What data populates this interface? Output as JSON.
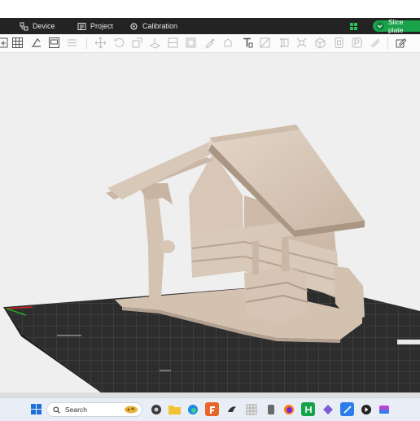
{
  "menubar": {
    "tabs": [
      {
        "label": "Device",
        "icon": "device-icon"
      },
      {
        "label": "Project",
        "icon": "project-icon"
      },
      {
        "label": "Calibration",
        "icon": "calibration-icon"
      }
    ],
    "slice_button_label": "Slice plate",
    "colors": {
      "background": "#232323",
      "accent": "#1aa34a"
    }
  },
  "toolbar": {
    "tools": [
      "add-object-icon",
      "arrange-grid-icon",
      "auto-orient-icon",
      "layout-plate-icon",
      "split-icon",
      "move-icon",
      "rotate-icon",
      "scale-icon",
      "lay-on-face-icon",
      "cut-icon",
      "mesh-boolean-icon",
      "support-paint-icon",
      "text-icon",
      "assembly-icon",
      "measure-icon",
      "cube-icon",
      "variable-layer-icon",
      "seam-paint-icon",
      "color-paint-icon",
      "fuzzy-skin-icon",
      "edit-icon"
    ]
  },
  "viewport": {
    "model": "3D model of a rustic wooden shed with well",
    "colors": {
      "model": "#d9c8b8",
      "plate": "#2d2d2d",
      "plate_grid": "#454545"
    }
  },
  "taskbar": {
    "search_placeholder": "Search",
    "apps": [
      "start-icon",
      "search-icon",
      "widget-icon",
      "file-explorer-icon",
      "edge-icon",
      "app-orange-icon",
      "app-bird-icon",
      "app-grid-icon",
      "firefox-icon",
      "app-green-icon",
      "app-purple-icon",
      "app-blue-icon",
      "app-media-icon",
      "app-gradient-icon"
    ]
  }
}
